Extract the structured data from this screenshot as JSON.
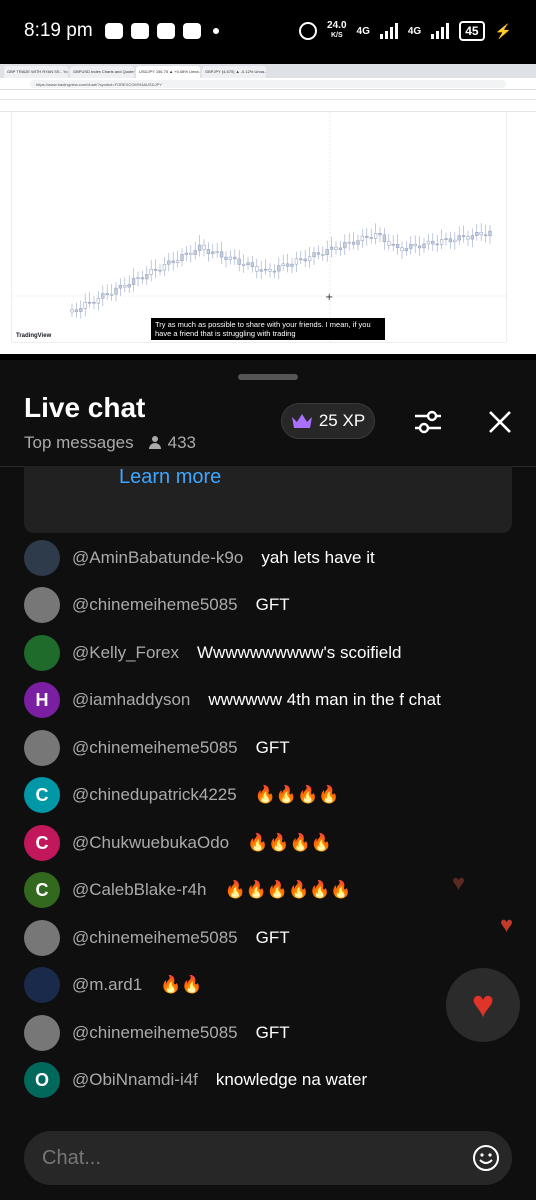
{
  "status_bar": {
    "time": "8:19 pm",
    "net_speed_value": "24.0",
    "net_speed_unit": "K/S",
    "network_1": "4G",
    "network_2": "4G",
    "battery": "45"
  },
  "video": {
    "caption": "Try as much as possible to share with your friends. I mean, if you have a friend that is struggling with trading",
    "logo": "TradingView",
    "tabs": [
      "GBP TRADE WITH RYAN SS - Yo...",
      "GBPUSD Index Charts and Quotes",
      "USDJPY 156.75 ▲ +0.08% Unna...",
      "GBPJPY (4,670) ▲ -0.12% Unna..."
    ],
    "url": "https://www.tradingview.com/chart/?symbol=FOREXCOM%3AUSDJPY"
  },
  "chat": {
    "title": "Live chat",
    "mode": "Top messages",
    "viewer_count": "433",
    "xp": "25 XP",
    "promo_link": "Learn more",
    "composer_placeholder": "Chat...",
    "messages": [
      {
        "author": "@AminBabatunde-k9o",
        "text": "yah lets have it",
        "avatar_letter": "",
        "avatar_color": "#2d3b4a"
      },
      {
        "author": "@chinemeiheme5085",
        "text": "GFT",
        "avatar_letter": "",
        "avatar_color": "#777777"
      },
      {
        "author": "@Kelly_Forex",
        "text": "Wwwwwwwwww's scoifield",
        "avatar_letter": "",
        "avatar_color": "#1f6b2b"
      },
      {
        "author": "@iamhaddyson",
        "text": "wwwwww 4th man in the f chat",
        "avatar_letter": "H",
        "avatar_color": "#7b1fa2"
      },
      {
        "author": "@chinemeiheme5085",
        "text": "GFT",
        "avatar_letter": "",
        "avatar_color": "#777777"
      },
      {
        "author": "@chinedupatrick4225",
        "text": "🔥🔥🔥🔥",
        "avatar_letter": "C",
        "avatar_color": "#0097a7"
      },
      {
        "author": "@ChukwuebukaOdo",
        "text": "🔥🔥🔥🔥",
        "avatar_letter": "C",
        "avatar_color": "#c2185b"
      },
      {
        "author": "@CalebBlake-r4h",
        "text": "🔥🔥🔥🔥🔥🔥",
        "avatar_letter": "C",
        "avatar_color": "#33691e"
      },
      {
        "author": "@chinemeiheme5085",
        "text": "GFT",
        "avatar_letter": "",
        "avatar_color": "#777777"
      },
      {
        "author": "@m.ard1",
        "text": "🔥🔥",
        "avatar_letter": "",
        "avatar_color": "#1a2a4a"
      },
      {
        "author": "@chinemeiheme5085",
        "text": "GFT",
        "avatar_letter": "",
        "avatar_color": "#777777"
      },
      {
        "author": "@ObiNnamdi-i4f",
        "text": "knowledge na water",
        "avatar_letter": "O",
        "avatar_color": "#00695c"
      }
    ]
  },
  "colors": {
    "background": "#0f0f0f",
    "link": "#3ea6ff",
    "like": "#e0342b",
    "crown": "#a970ff"
  }
}
